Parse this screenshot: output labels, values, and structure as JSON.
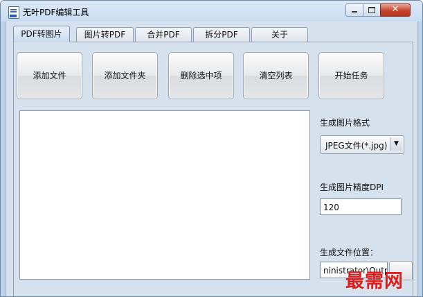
{
  "window": {
    "title": "无叶PDF编辑工具",
    "close_glyph": "✕"
  },
  "tabs": [
    {
      "label": "PDF转图片",
      "active": true
    },
    {
      "label": "图片转PDF"
    },
    {
      "label": "合并PDF"
    },
    {
      "label": "拆分PDF"
    },
    {
      "label": "关于"
    }
  ],
  "toolbar": {
    "add_file": "添加文件",
    "add_folder": "添加文件夹",
    "delete_selected": "删除选中项",
    "clear_list": "清空列表",
    "start_task": "开始任务"
  },
  "options": {
    "format_label": "生成图片格式",
    "format_value": "JPEG文件(*.jpg)",
    "dpi_label": "生成图片精度DPI",
    "dpi_value": "120",
    "location_label": "生成文件位置：",
    "location_value": "ninistrator\\Output"
  },
  "watermark": "最需网",
  "icons": [
    "app-pdf-icon",
    "minimize-icon",
    "maximize-icon",
    "close-icon",
    "dropdown-arrow-icon"
  ]
}
